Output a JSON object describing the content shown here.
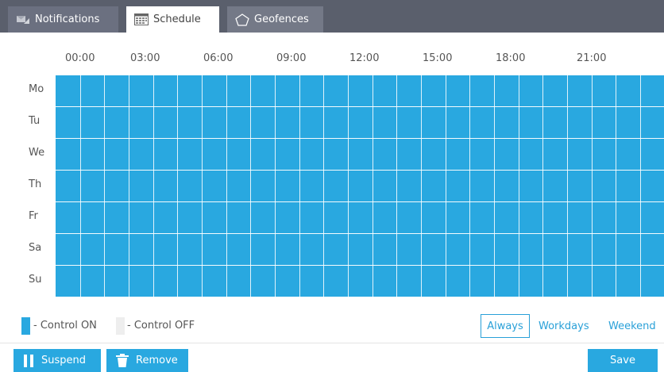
{
  "tabs": [
    {
      "label": "Notifications",
      "icon": "notifications-icon"
    },
    {
      "label": "Schedule",
      "icon": "calendar-grid-icon"
    },
    {
      "label": "Geofences",
      "icon": "pentagon-icon"
    }
  ],
  "active_tab": "Schedule",
  "hours": [
    "00:00",
    "03:00",
    "06:00",
    "09:00",
    "12:00",
    "15:00",
    "18:00",
    "21:00"
  ],
  "days": [
    "Mo",
    "Tu",
    "We",
    "Th",
    "Fr",
    "Sa",
    "Su"
  ],
  "schedule_state": "all cells Control ON",
  "legend": {
    "on_label": "- Control ON",
    "off_label": "- Control OFF"
  },
  "presets": {
    "always": "Always",
    "workdays": "Workdays",
    "weekend": "Weekend",
    "selected": "Always"
  },
  "buttons": {
    "suspend": "Suspend",
    "remove": "Remove",
    "save": "Save"
  },
  "colors": {
    "accent": "#29a8e0",
    "on": "#29a8e0",
    "off": "#eeeeee",
    "tabbar": "#5a5f6c"
  }
}
